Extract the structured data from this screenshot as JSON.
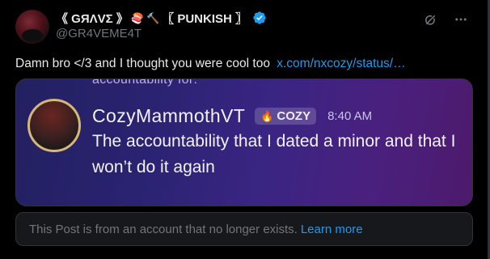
{
  "tweet": {
    "display_name_part1": "《 GЯΛVΣ 》",
    "emoji_1": "🍣",
    "emoji_2": "🔨",
    "display_name_part2": "〖 PUNKISH 〗",
    "handle": "@GR4VEME4T",
    "text": "Damn bro </3 and I thought you were cool too",
    "link": "x.com/nxcozy/status/…"
  },
  "media": {
    "cut_text": "accountability for:",
    "name": "CozyMammothVT",
    "badge": "COZY",
    "time": "8:40 AM",
    "message": "The accountability that I dated a minor and that I won’t do it again"
  },
  "notice": {
    "text": "This Post is from an account that no longer exists.",
    "link": "Learn more"
  },
  "icons": [
    "verified-badge-icon",
    "grok-icon",
    "more-icon",
    "fire-icon"
  ],
  "colors": {
    "accent": "#1d9bf0",
    "muted": "#71767b",
    "text": "#e7e9ea",
    "background": "#000000"
  }
}
